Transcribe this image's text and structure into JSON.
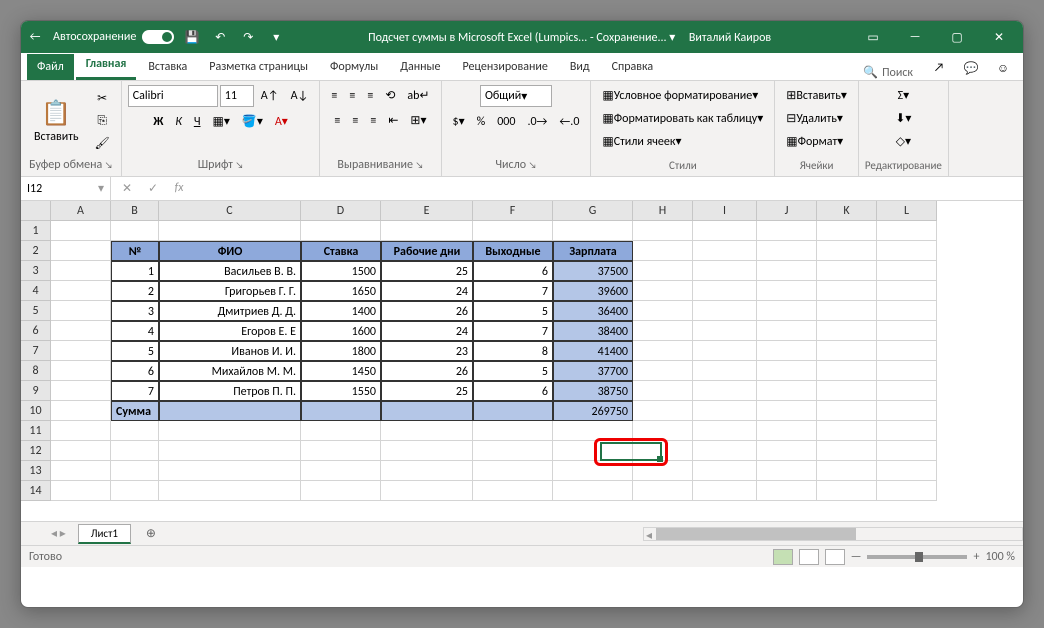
{
  "titlebar": {
    "autosave_label": "Автосохранение",
    "doc_title": "Подсчет суммы в Microsoft Excel (Lumpics...  -  Сохранение...  ▾",
    "user": "Виталий Каиров"
  },
  "tabs": {
    "file": "Файл",
    "home": "Главная",
    "insert": "Вставка",
    "layout": "Разметка страницы",
    "formulas": "Формулы",
    "data": "Данные",
    "review": "Рецензирование",
    "view": "Вид",
    "help": "Справка",
    "search": "Поиск"
  },
  "ribbon": {
    "paste": "Вставить",
    "clipboard": "Буфер обмена",
    "font_name": "Calibri",
    "font_size": "11",
    "font_group": "Шрифт",
    "bold": "Ж",
    "italic": "К",
    "underline": "Ч",
    "alignment": "Выравнивание",
    "number_format": "Общий",
    "number_group": "Число",
    "cond_fmt": "Условное форматирование",
    "fmt_table": "Форматировать как таблицу",
    "cell_styles": "Стили ячеек",
    "styles_group": "Стили",
    "insert_cells": "Вставить",
    "delete_cells": "Удалить",
    "format_cells": "Формат",
    "cells_group": "Ячейки",
    "editing_group": "Редактирование"
  },
  "namebox": "I12",
  "columns": [
    "A",
    "B",
    "C",
    "D",
    "E",
    "F",
    "G",
    "H",
    "I",
    "J",
    "K",
    "L"
  ],
  "rows": [
    "1",
    "2",
    "3",
    "4",
    "5",
    "6",
    "7",
    "8",
    "9",
    "10",
    "11",
    "12",
    "13",
    "14"
  ],
  "table": {
    "headers": [
      "№",
      "ФИО",
      "Ставка",
      "Рабочие дни",
      "Выходные",
      "Зарплата"
    ],
    "data": [
      [
        "1",
        "Васильев В. В.",
        "1500",
        "25",
        "6",
        "37500"
      ],
      [
        "2",
        "Григорьев Г. Г.",
        "1650",
        "24",
        "7",
        "39600"
      ],
      [
        "3",
        "Дмитриев Д. Д.",
        "1400",
        "26",
        "5",
        "36400"
      ],
      [
        "4",
        "Егоров Е. Е",
        "1600",
        "24",
        "7",
        "38400"
      ],
      [
        "5",
        "Иванов И. И.",
        "1800",
        "23",
        "8",
        "41400"
      ],
      [
        "6",
        "Михайлов М. М.",
        "1450",
        "26",
        "5",
        "37700"
      ],
      [
        "7",
        "Петров П. П.",
        "1550",
        "25",
        "6",
        "38750"
      ]
    ],
    "sum_label": "Сумма",
    "sum_total": "269750"
  },
  "sheet": "Лист1",
  "status": "Готово",
  "zoom": "100 %"
}
